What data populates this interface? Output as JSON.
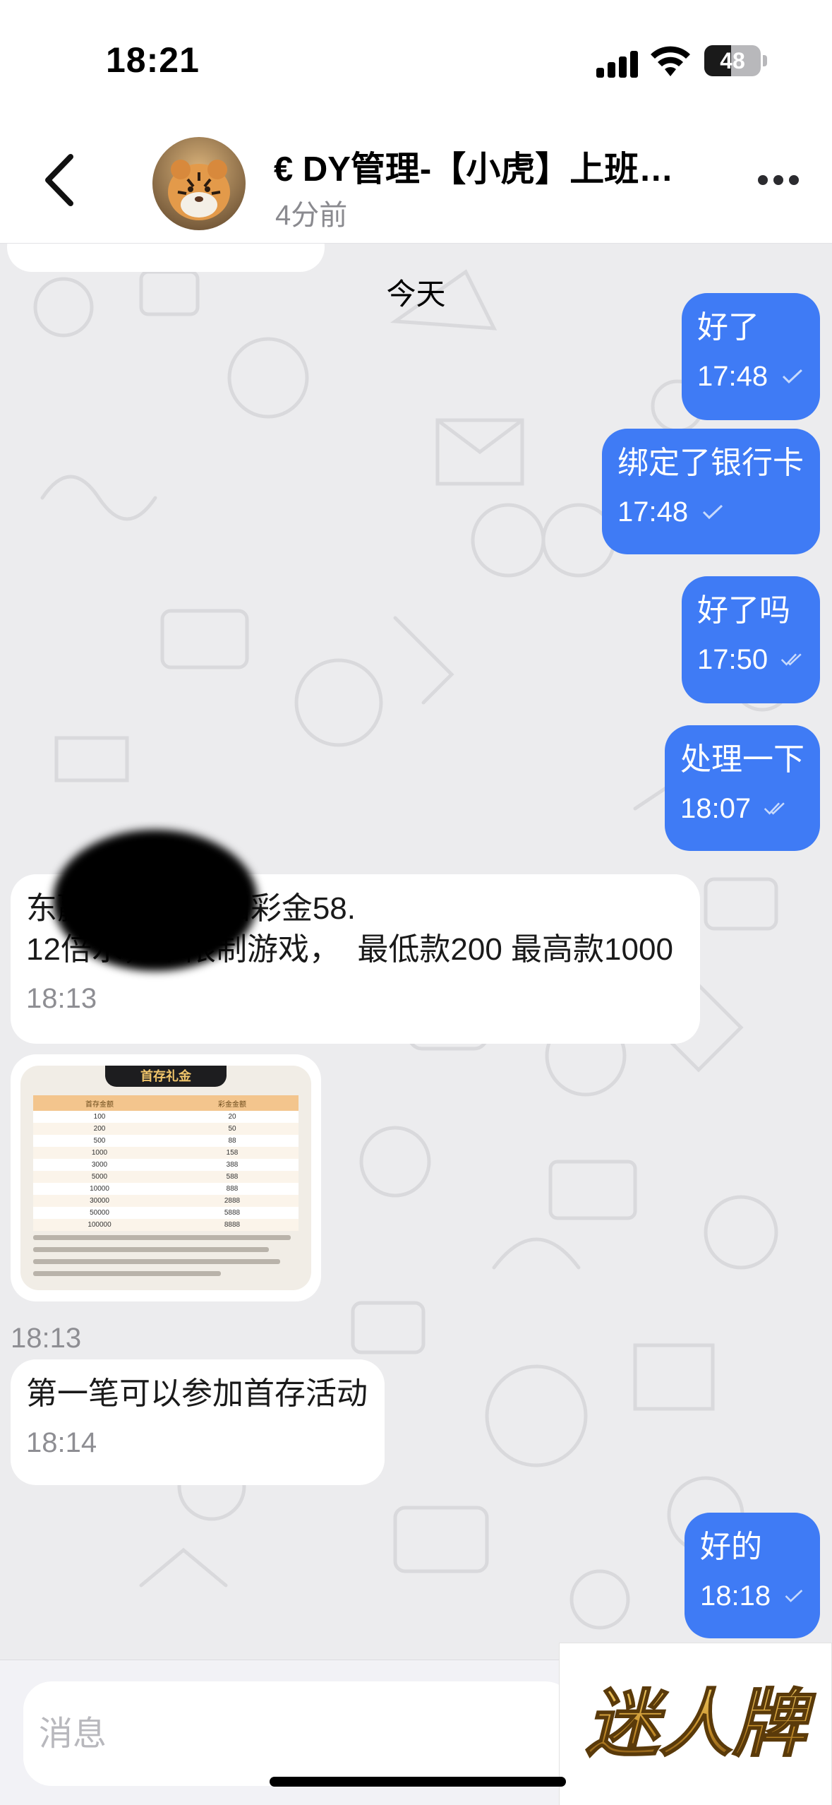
{
  "status_bar": {
    "time": "18:21",
    "battery_level": "48",
    "icons": [
      "signal-icon",
      "wifi-icon",
      "battery-icon"
    ]
  },
  "header": {
    "back_icon": "chevron-left-icon",
    "title": "€ DY管理-【小虎】上班时间",
    "subtitle": "4分前",
    "more_icon": "more-horizontal-icon"
  },
  "chat": {
    "date_divider": "今天",
    "messages": [
      {
        "direction": "out",
        "text": "好了",
        "time": "17:48",
        "status": "sent"
      },
      {
        "direction": "out",
        "text": "绑定了银行卡",
        "time": "17:48",
        "status": "sent"
      },
      {
        "direction": "out",
        "text": "好了吗",
        "time": "17:50",
        "status": "read"
      },
      {
        "direction": "out",
        "text": "处理一下",
        "time": "18:07",
        "status": "read"
      },
      {
        "direction": "in",
        "text": "东赢V3特邀回归彩金58.\n12倍水，不限制游戏，  最低款200 最高款1000",
        "time": "18:13"
      },
      {
        "direction": "in",
        "type": "image",
        "time": "18:13"
      },
      {
        "direction": "in",
        "text": "第一笔可以参加首存活动",
        "time": "18:14"
      },
      {
        "direction": "out",
        "text": "好的",
        "time": "18:18",
        "status": "sent"
      }
    ],
    "promo_image": {
      "title": "首存礼金",
      "headers": [
        "首存金额",
        "彩金金额"
      ],
      "rows": [
        [
          "100",
          "20"
        ],
        [
          "200",
          "50"
        ],
        [
          "500",
          "88"
        ],
        [
          "1000",
          "158"
        ],
        [
          "3000",
          "388"
        ],
        [
          "5000",
          "588"
        ],
        [
          "10000",
          "888"
        ],
        [
          "30000",
          "2888"
        ],
        [
          "50000",
          "5888"
        ],
        [
          "100000",
          "8888"
        ]
      ]
    }
  },
  "input": {
    "placeholder": "消息"
  },
  "watermark": {
    "text": "迷人牌",
    "color": "#c8902a"
  },
  "colors": {
    "outgoing_bubble": "#3f7bf5",
    "incoming_bubble": "#ffffff",
    "chat_background": "#ececee"
  }
}
